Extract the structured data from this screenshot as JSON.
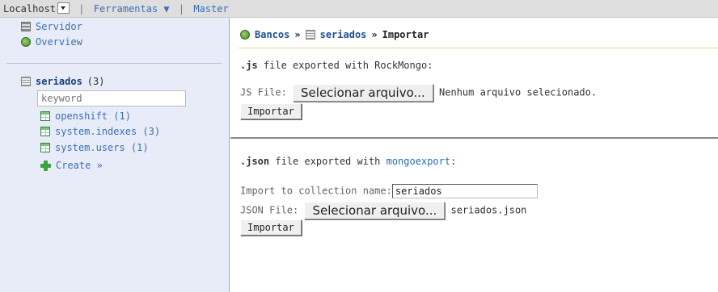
{
  "topbar": {
    "server": "Localhost",
    "separator1": "|",
    "tools": "Ferramentas ▼",
    "separator2": "|",
    "master": "Master"
  },
  "sidebar": {
    "server": "Servidor",
    "overview": "Overview",
    "db": {
      "name": "seriados",
      "count": "(3)"
    },
    "keyword_placeholder": "keyword",
    "collections": [
      {
        "label": "openshift (1)"
      },
      {
        "label": "system.indexes (3)"
      },
      {
        "label": "system.users (1)"
      }
    ],
    "create": "Create »"
  },
  "breadcrumb": {
    "databases": "Bancos",
    "sep1": "»",
    "db": "seriados",
    "sep2": "»",
    "page": "Importar"
  },
  "js_section": {
    "heading_bold": ".js",
    "heading_rest": " file exported with RockMongo:",
    "file_label": "JS File:",
    "choose_button": "Selecionar arquivo...",
    "file_status": "Nenhum arquivo selecionado.",
    "import_button": "Importar"
  },
  "json_section": {
    "heading_bold": ".json",
    "heading_mid": " file exported with ",
    "heading_link": "mongoexport",
    "heading_end": ":",
    "collection_label": "Import to collection name:",
    "collection_value": "seriados",
    "file_label": "JSON File:",
    "choose_button": "Selecionar arquivo...",
    "file_name": "seriados.json",
    "import_button": "Importar"
  }
}
